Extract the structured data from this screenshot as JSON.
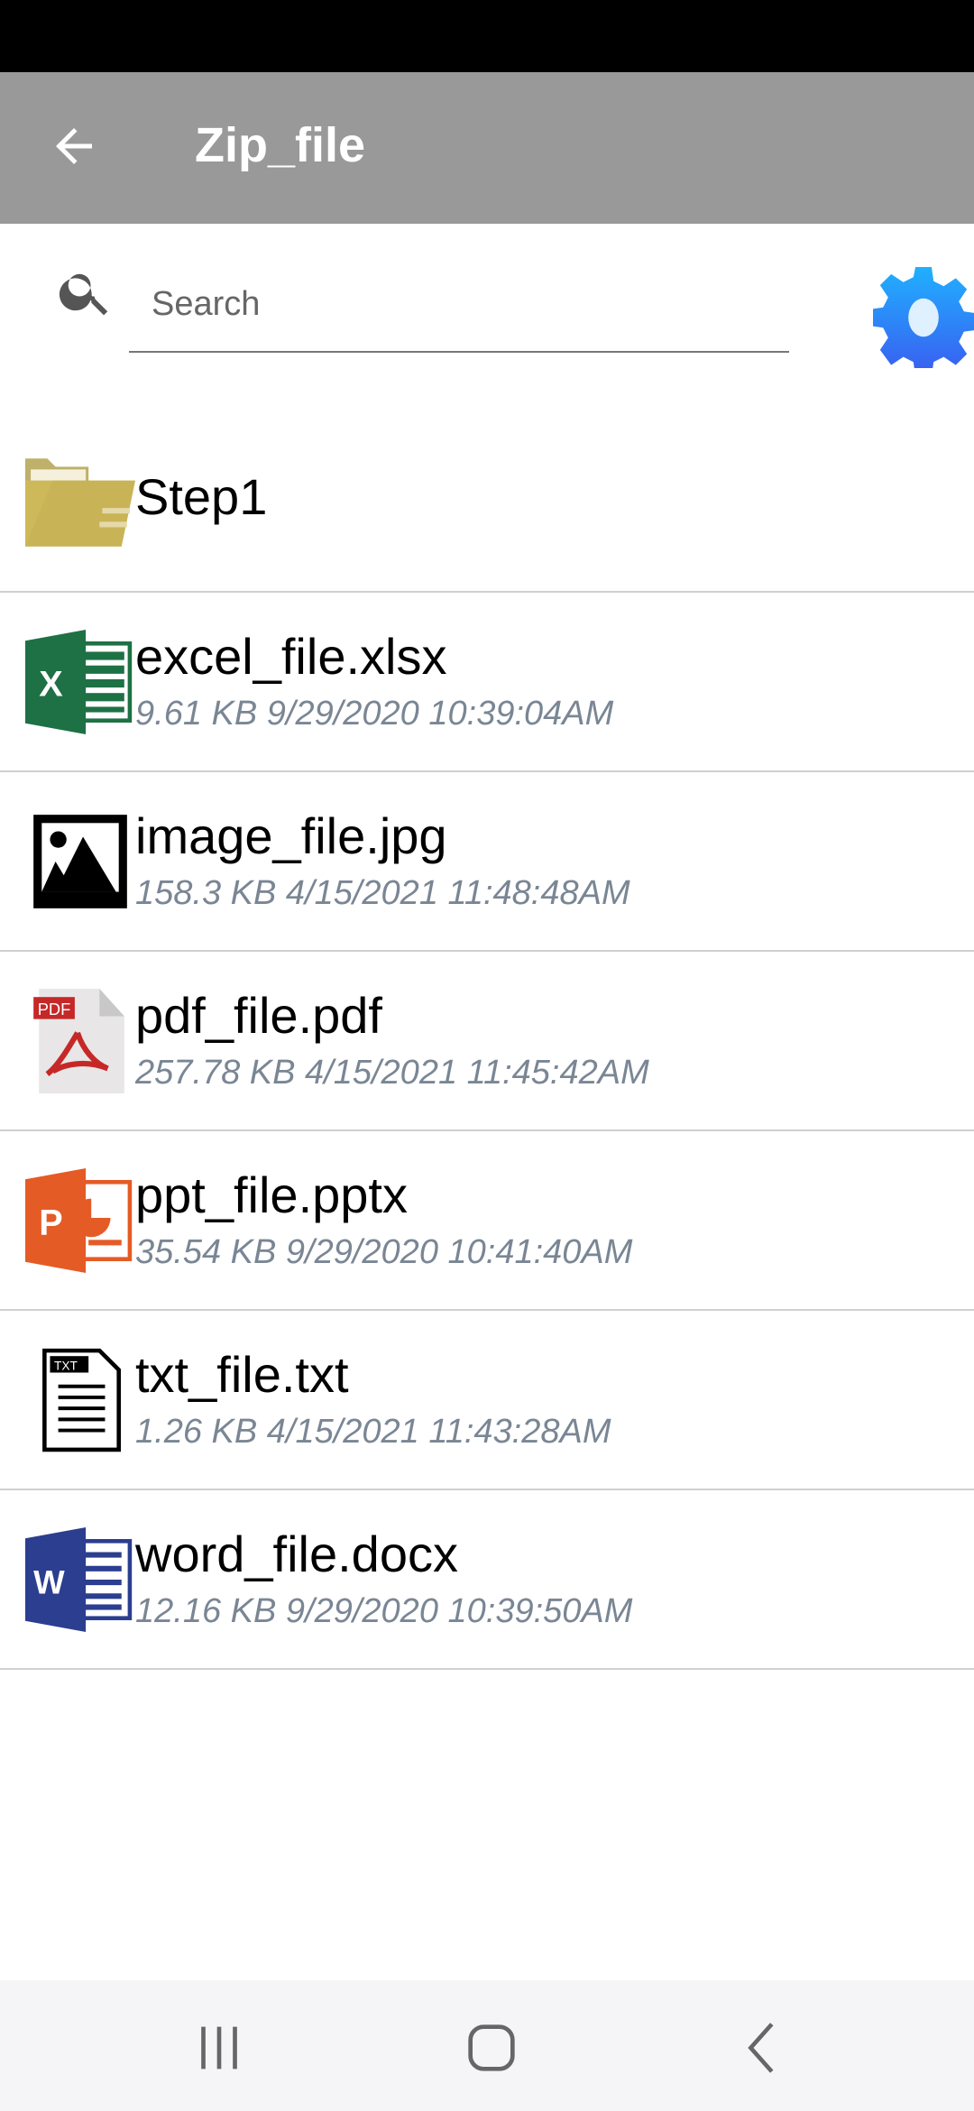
{
  "appbar": {
    "title": "Zip_file"
  },
  "search": {
    "placeholder": "Search"
  },
  "items": [
    {
      "name": "Step1",
      "type": "folder",
      "meta": ""
    },
    {
      "name": "excel_file.xlsx",
      "type": "excel",
      "meta": "9.61 KB  9/29/2020 10:39:04AM"
    },
    {
      "name": "image_file.jpg",
      "type": "image",
      "meta": "158.3 KB  4/15/2021 11:48:48AM"
    },
    {
      "name": "pdf_file.pdf",
      "type": "pdf",
      "meta": "257.78 KB  4/15/2021 11:45:42AM",
      "icon_text": "PDF"
    },
    {
      "name": "ppt_file.pptx",
      "type": "powerpoint",
      "meta": "35.54 KB  9/29/2020 10:41:40AM"
    },
    {
      "name": "txt_file.txt",
      "type": "text",
      "meta": "1.26 KB  4/15/2021 11:43:28AM",
      "icon_text": "TXT"
    },
    {
      "name": "word_file.docx",
      "type": "word",
      "meta": "12.16 KB  9/29/2020 10:39:50AM"
    }
  ],
  "colors": {
    "appbar": "#999999",
    "gear": "#2f8cf5",
    "excel": "#1e7145",
    "ppt": "#e55b25",
    "word": "#2b3e8f",
    "folder": "#cdb95a",
    "pdf": "#c62828"
  }
}
